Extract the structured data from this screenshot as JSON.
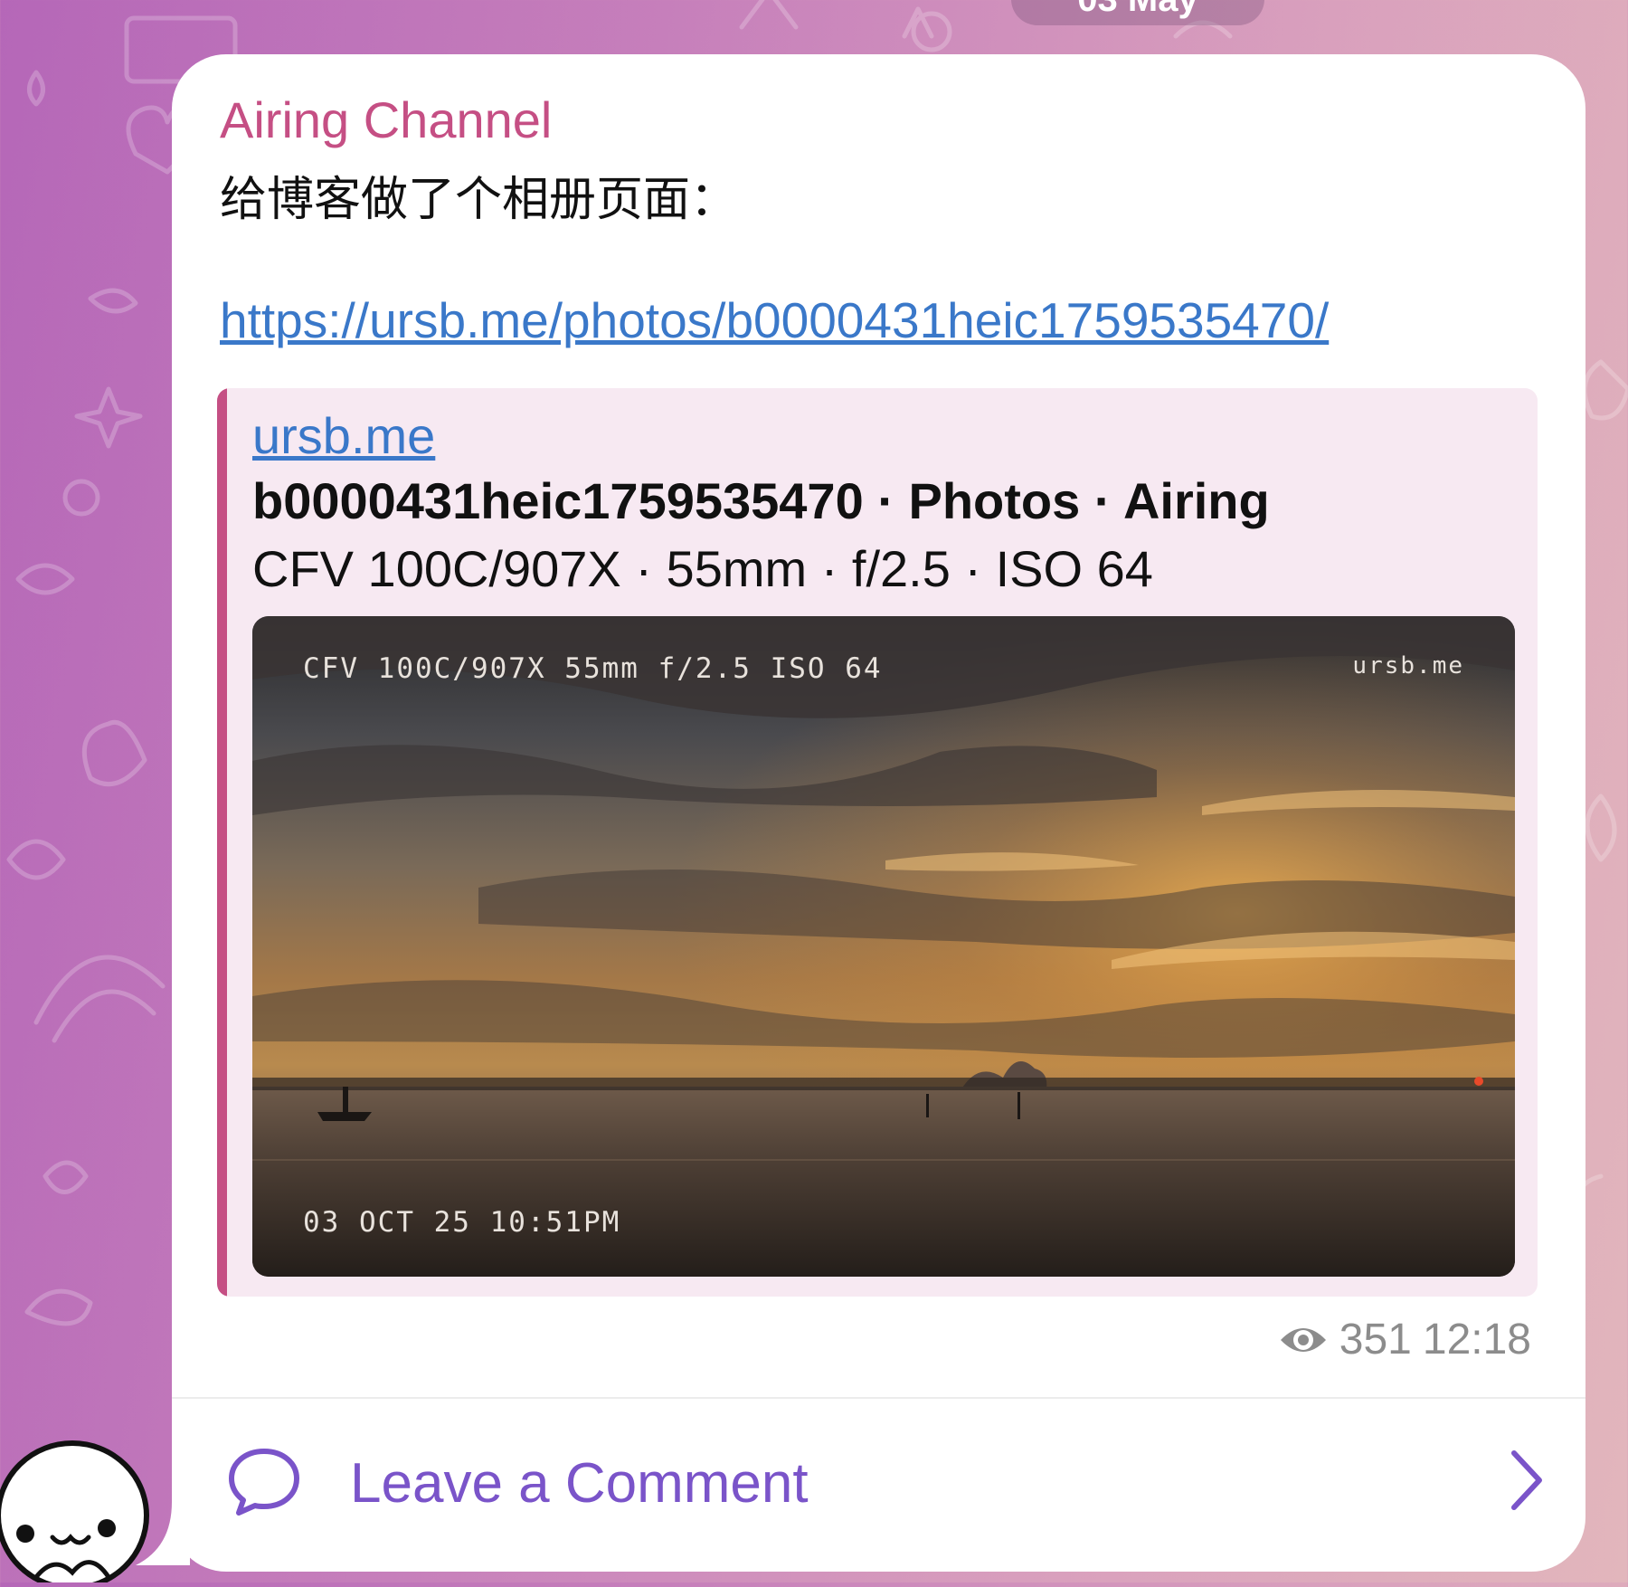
{
  "date_pill": "03 May",
  "message": {
    "channel_name": "Airing Channel",
    "text": "给博客做了个相册页面：",
    "link": "https://ursb.me/photos/b0000431heic1759535470/",
    "link_preview": {
      "site": "ursb.me",
      "title": "b0000431heic1759535470 · Photos · Airing",
      "description": "CFV 100C/907X · 55mm · f/2.5 · ISO 64",
      "photo": {
        "overlay_camera": "CFV 100C/907X 55mm f/2.5 ISO 64",
        "overlay_site": "ursb.me",
        "overlay_date": "03 OCT 25 10:51PM"
      }
    },
    "views": "351",
    "time": "12:18"
  },
  "comment_bar": {
    "label": "Leave a Comment"
  },
  "colors": {
    "channel_name": "#c54f84",
    "link": "#3a78c9",
    "comment_accent": "#7a54c9",
    "preview_background": "#f7e9f2"
  }
}
